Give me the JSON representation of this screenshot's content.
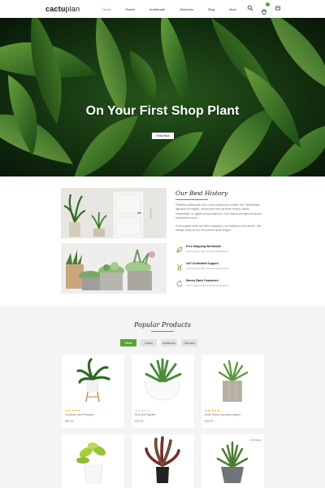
{
  "header": {
    "logo_bold": "cactu",
    "logo_rest": "plan",
    "nav": [
      "Home",
      "Plants",
      "Auldetraph",
      "Glachees",
      "Blog",
      "More"
    ]
  },
  "hero": {
    "title": "On Your First Shop Plant",
    "button": "Shop Now"
  },
  "history": {
    "title": "Our Best History",
    "text1": "Phasellus malesuada a leo a porta ullamcorper porttitor nisl. Pellentesque dignissim leo sagittis, ullamcorper libero sit amet, tempor mauris, suspendisse. In sagittis cursus massa ac. Duis vitae purus eget erat lacinia, sollicitudin et ac mi.",
    "text2": "Proin sodales lorem nec tellus vestibulum, vel vestibulum velit laoreet. Sed tristique turpis eu dui, nec pulvinar quam feugiat.",
    "features": [
      {
        "title": "Free Shipping Worldwide",
        "desc": "Lorem ipsum dolor sit amet consectetur"
      },
      {
        "title": "24/7 Dedicated Support",
        "desc": "Lorem ipsum dolor sit amet consectetur"
      },
      {
        "title": "Money Back Guarantee",
        "desc": "Lorem ipsum dolor sit amet consectetur"
      }
    ]
  },
  "popular": {
    "title": "Popular Products",
    "tabs": [
      "Plants",
      "Cactus",
      "Auldetraph",
      "Glachees"
    ],
    "products": [
      {
        "stars": "★★★★★",
        "name": "Cumirisen wios Pleriques",
        "price": "$59.00"
      },
      {
        "stars": "★★★★★",
        "name": "Reis Sint Faguiten",
        "price": "$32.00"
      },
      {
        "stars": "★★★★★",
        "name": "Nulla Viverra accumsan aliquet",
        "price": "$35.00"
      }
    ],
    "sale_label": "ON SALE"
  }
}
